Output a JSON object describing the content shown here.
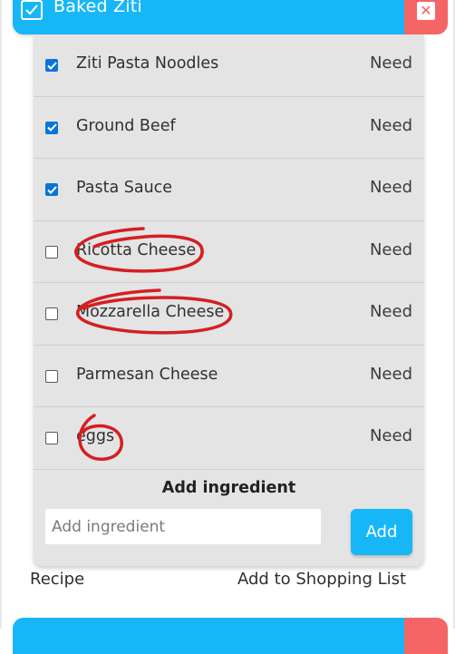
{
  "recipe": {
    "title": "Baked Ziti",
    "header_checked": true,
    "delete_icon": "x-icon"
  },
  "ingredients": [
    {
      "name": "Ziti Pasta Noodles",
      "status": "Need",
      "checked": true
    },
    {
      "name": "Ground Beef",
      "status": "Need",
      "checked": true
    },
    {
      "name": "Pasta Sauce",
      "status": "Need",
      "checked": true
    },
    {
      "name": "Ricotta Cheese",
      "status": "Need",
      "checked": false
    },
    {
      "name": "Mozzarella Cheese",
      "status": "Need",
      "checked": false
    },
    {
      "name": "Parmesan Cheese",
      "status": "Need",
      "checked": false
    },
    {
      "name": "eggs",
      "status": "Need",
      "checked": false
    }
  ],
  "add_form": {
    "title": "Add ingredient",
    "placeholder": "Add ingredient",
    "value": "",
    "button_label": "Add"
  },
  "footer": {
    "recipe_link": "Recipe",
    "shopping_link": "Add to Shopping List"
  },
  "colors": {
    "header_blue": "#17b7f7",
    "delete_red": "#f56566",
    "panel_gray": "#e4e4e4",
    "checkbox_blue": "#0a75d6",
    "annotation_red": "#d41f22"
  }
}
